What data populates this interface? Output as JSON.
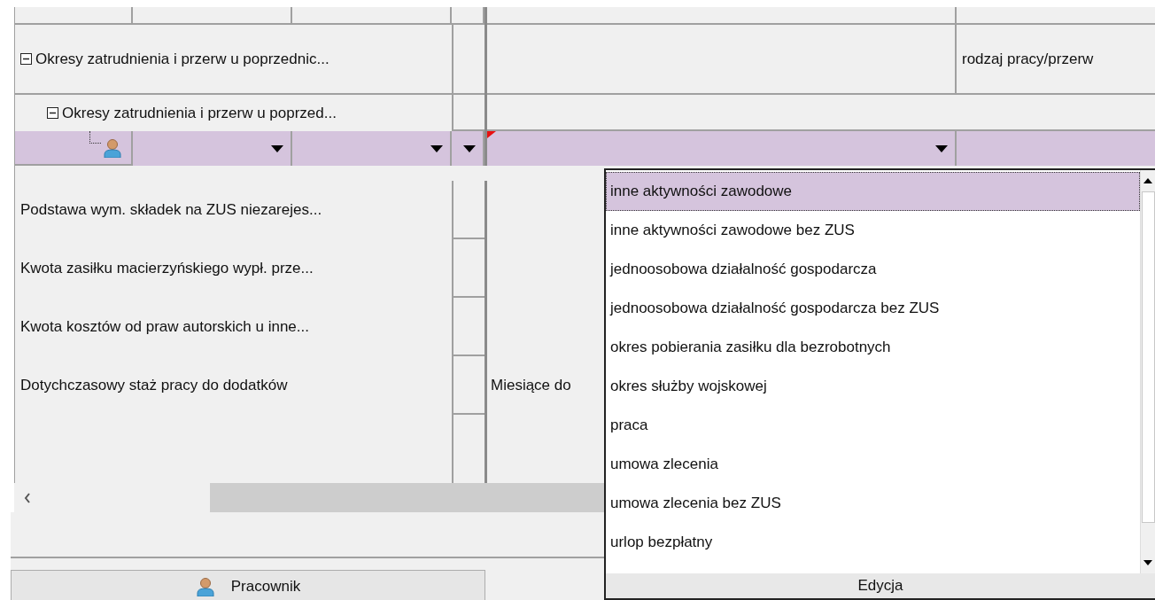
{
  "grid": {
    "rows": [
      {
        "kind": "header"
      },
      {
        "kind": "group",
        "label": "Okresy zatrudnienia i przerw u poprzednic...",
        "expanded": true,
        "cell": "rodzaj pracy/przerw"
      },
      {
        "kind": "subgroup",
        "label": "Okresy zatrudnienia i przerw u poprzed...",
        "expanded": true
      },
      {
        "kind": "edit",
        "selected": true
      },
      {
        "kind": "field",
        "label": "Podstawa wym. składek na ZUS niezarejes..."
      },
      {
        "kind": "field",
        "label": "Kwota zasiłku macierzyńskiego wypł. prze..."
      },
      {
        "kind": "field",
        "label": "Kwota kosztów od praw autorskich u inne..."
      },
      {
        "kind": "field",
        "label": "Dotychczasowy staż pracy do dodatków",
        "value": "Miesiące do"
      },
      {
        "kind": "field"
      }
    ]
  },
  "dropdown": {
    "items": [
      {
        "label": "inne aktywności zawodowe",
        "selected": true
      },
      {
        "label": "inne aktywności zawodowe bez ZUS",
        "selected": false
      },
      {
        "label": "jednoosobowa działalność gospodarcza",
        "selected": false
      },
      {
        "label": "jednoosobowa działalność gospodarcza bez ZUS",
        "selected": false
      },
      {
        "label": "okres pobierania zasiłku dla bezrobotnych",
        "selected": false
      },
      {
        "label": "okres służby wojskowej",
        "selected": false
      },
      {
        "label": "praca",
        "selected": false
      },
      {
        "label": "umowa zlecenia",
        "selected": false
      },
      {
        "label": "umowa zlecenia bez ZUS",
        "selected": false
      },
      {
        "label": "urlop bezpłatny",
        "selected": false
      }
    ],
    "footer": "Edycja"
  },
  "tabs": [
    {
      "label": "Pracownik"
    }
  ]
}
